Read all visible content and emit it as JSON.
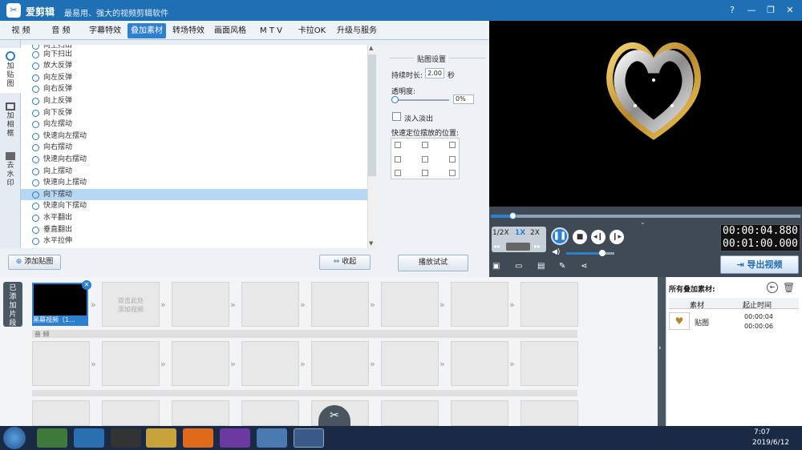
{
  "title_bar": {
    "logo": "✂",
    "app_name": "爱剪辑",
    "slogan": "最易用、强大的视频剪辑软件",
    "controls": [
      "?",
      "—",
      "❐",
      "✕"
    ]
  },
  "tabs": [
    {
      "label": "视 频"
    },
    {
      "label": "音 频"
    },
    {
      "label": "字幕特效"
    },
    {
      "label": "叠加素材",
      "active": true
    },
    {
      "label": "转场特效"
    },
    {
      "label": "画面风格"
    },
    {
      "label": "M T V"
    },
    {
      "label": "卡拉OK"
    },
    {
      "label": "升级与服务"
    }
  ],
  "left_tabs": [
    {
      "label": "加贴图",
      "active": true
    },
    {
      "label": "加相框"
    },
    {
      "label": "去水印"
    }
  ],
  "effect_list": [
    {
      "label": "向上扫出"
    },
    {
      "label": "向下扫出"
    },
    {
      "label": "放大反弹"
    },
    {
      "label": "向左反弹"
    },
    {
      "label": "向右反弹"
    },
    {
      "label": "向上反弹"
    },
    {
      "label": "向下反弹"
    },
    {
      "label": "向左摆动"
    },
    {
      "label": "快速向左摆动"
    },
    {
      "label": "向右摆动"
    },
    {
      "label": "快速向右摆动"
    },
    {
      "label": "向上摆动"
    },
    {
      "label": "快速向上摆动"
    },
    {
      "label": "向下摆动",
      "selected": true
    },
    {
      "label": "快速向下摆动"
    },
    {
      "label": "水平翻出"
    },
    {
      "label": "垂直翻出"
    },
    {
      "label": "水平拉伸"
    }
  ],
  "buttons": {
    "add_sticker": "添加贴图",
    "collapse": "收起",
    "preview_test": "播放试试",
    "export": "导出视频"
  },
  "sticker_settings": {
    "title": "贴图设置",
    "duration_label": "持续时长:",
    "duration_value": "2.00",
    "duration_unit": "秒",
    "opacity_label": "透明度:",
    "opacity_value": "0%",
    "fade_label": "淡入淡出",
    "quick_pos_label": "快速定位摆放的位置:"
  },
  "player": {
    "speed_options": [
      "1/2X",
      "1X",
      "2X"
    ],
    "active_speed": "1X",
    "current_time": "00:00:04.880",
    "total_time": "00:01:00.000",
    "progress": 0.07,
    "volume": 0.75
  },
  "clips": {
    "side_label": "已添加片段",
    "clip1_label": "黑幕视频（1...",
    "add_hint": "双击此处\n添加视频",
    "audio_label": "音 频"
  },
  "overlay_panel": {
    "title": "所有叠加素材:",
    "col_material": "素材",
    "col_time": "起止时间",
    "item_name": "贴图",
    "item_start": "00:00:04",
    "item_end": "00:00:06"
  },
  "taskbar": {
    "time": "7:07",
    "date": "2019/6/12"
  },
  "colors": {
    "accent": "#2d7fd0",
    "titlebar": "#1f6fb5",
    "selected_row": "#b7d8f5",
    "time_text": "#ffffff"
  }
}
